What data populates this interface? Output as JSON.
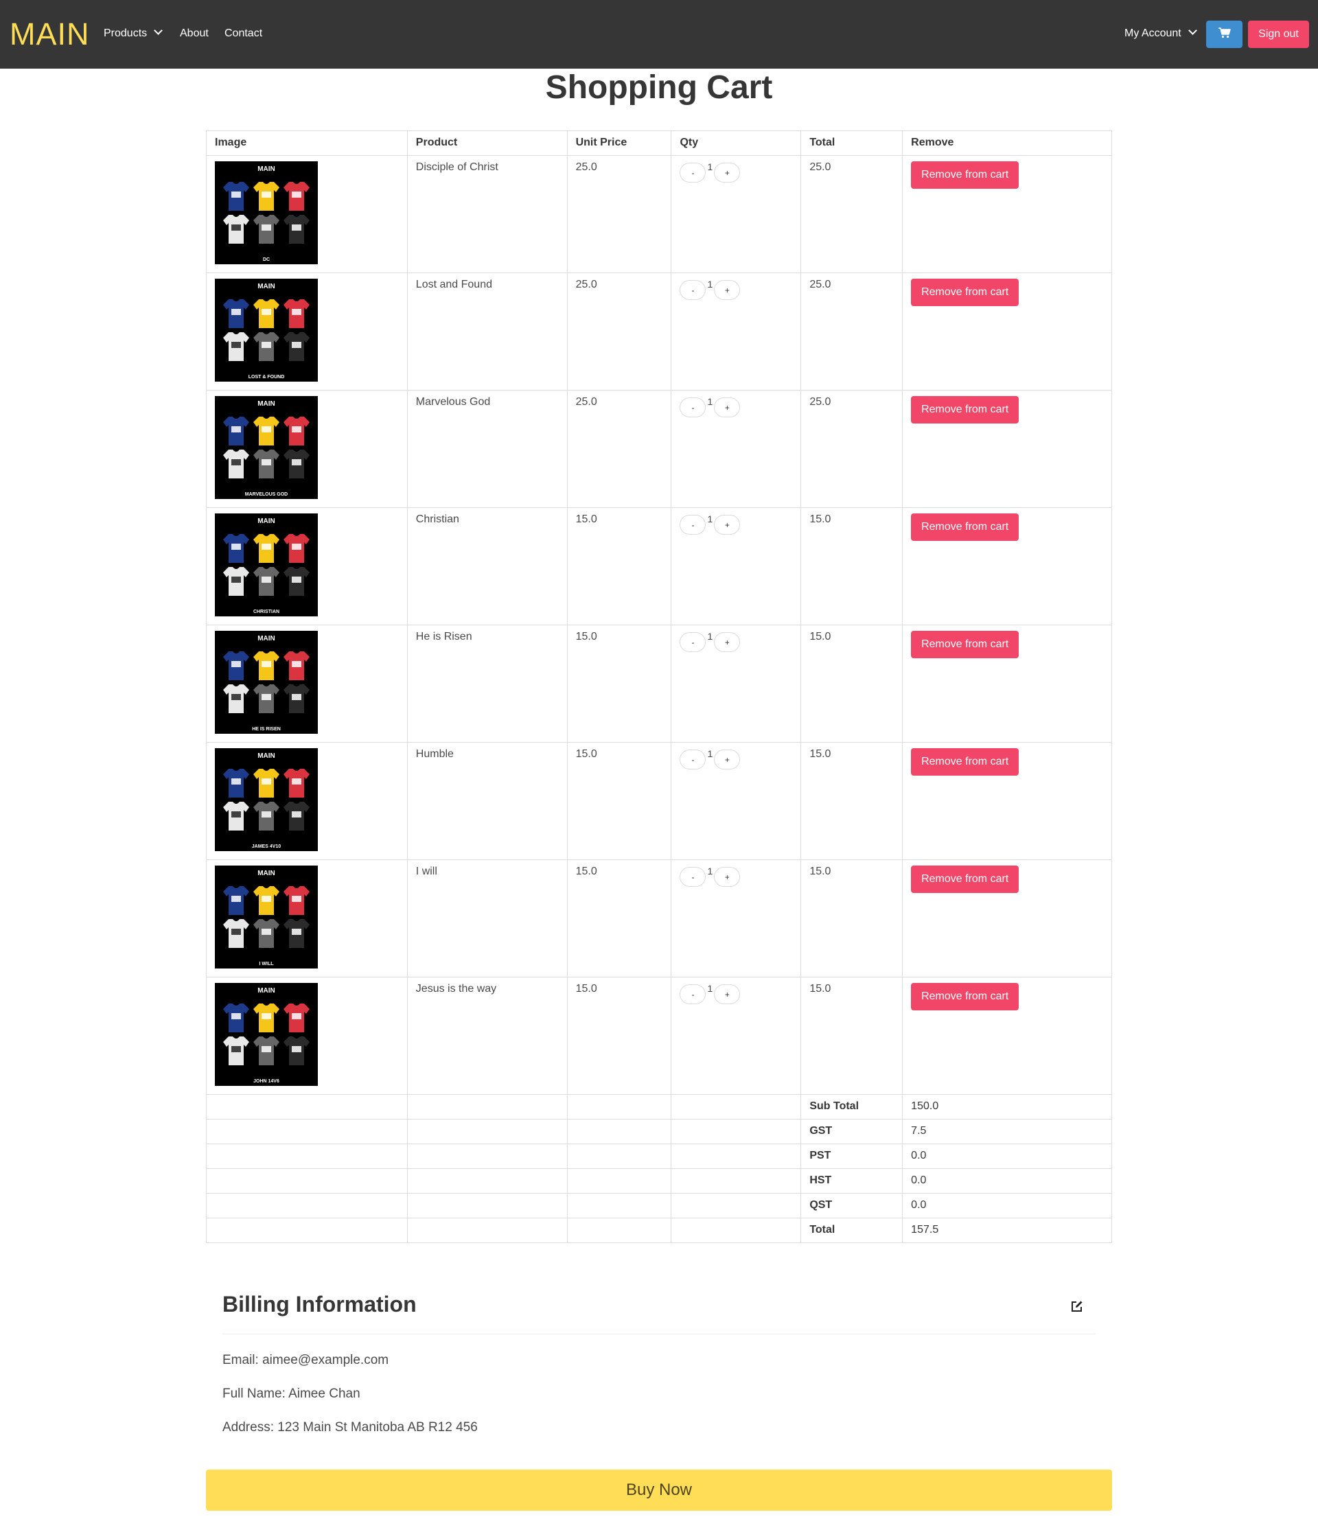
{
  "colors": {
    "navbar": "#363636",
    "brand": "#ffdd57",
    "info": "#3e8ed0",
    "danger": "#f14668",
    "warning": "#ffdd57"
  },
  "nav": {
    "brand": "MAIN",
    "products": "Products",
    "about": "About",
    "contact": "Contact",
    "my_account": "My Account",
    "cart_icon": "cart-icon",
    "sign_out": "Sign out"
  },
  "title": "Shopping Cart",
  "table": {
    "headers": [
      "Image",
      "Product",
      "Unit Price",
      "Qty",
      "Total",
      "Remove"
    ],
    "items": [
      {
        "product": "Disciple of Christ",
        "unit_price": "25.0",
        "qty": "1",
        "total": "25.0",
        "caption": "DC",
        "design": "dc"
      },
      {
        "product": "Lost and Found",
        "unit_price": "25.0",
        "qty": "1",
        "total": "25.0",
        "caption": "LOST & FOUND",
        "design": "lf"
      },
      {
        "product": "Marvelous God",
        "unit_price": "25.0",
        "qty": "1",
        "total": "25.0",
        "caption": "MARVELOUS GOD",
        "design": "mg"
      },
      {
        "product": "Christian",
        "unit_price": "15.0",
        "qty": "1",
        "total": "15.0",
        "caption": "CHRISTIAN",
        "design": "ch"
      },
      {
        "product": "He is Risen",
        "unit_price": "15.0",
        "qty": "1",
        "total": "15.0",
        "caption": "HE IS RISEN",
        "design": "hr"
      },
      {
        "product": "Humble",
        "unit_price": "15.0",
        "qty": "1",
        "total": "15.0",
        "caption": "JAMES 4V10",
        "design": "hu"
      },
      {
        "product": "I will",
        "unit_price": "15.0",
        "qty": "1",
        "total": "15.0",
        "caption": "I WILL",
        "design": "iw"
      },
      {
        "product": "Jesus is the way",
        "unit_price": "15.0",
        "qty": "1",
        "total": "15.0",
        "caption": "JOHN 14V6",
        "design": "jw"
      }
    ],
    "thumb_logo": "MAIN",
    "minus_label": "-",
    "plus_label": "+",
    "remove_label": "Remove from cart",
    "summary": [
      {
        "label": "Sub Total",
        "value": "150.0"
      },
      {
        "label": "GST",
        "value": "7.5"
      },
      {
        "label": "PST",
        "value": "0.0"
      },
      {
        "label": "HST",
        "value": "0.0"
      },
      {
        "label": "QST",
        "value": "0.0"
      },
      {
        "label": "Total",
        "value": "157.5"
      }
    ]
  },
  "billing": {
    "title": "Billing Information",
    "edit_icon": "edit-icon",
    "email": "Email: aimee@example.com",
    "full_name": "Full Name: Aimee Chan",
    "address": "Address: 123 Main St Manitoba AB R12 456"
  },
  "buy_now": "Buy Now"
}
